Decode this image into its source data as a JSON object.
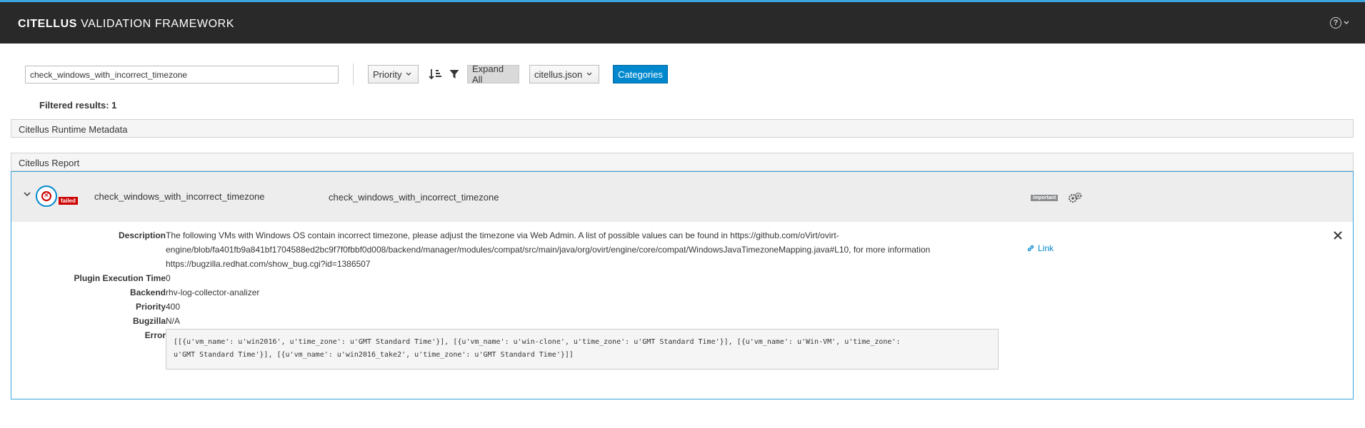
{
  "app": {
    "brand_bold": "CITELLUS",
    "brand_rest": "VALIDATION FRAMEWORK",
    "help_icon": "question-circle-icon"
  },
  "toolbar": {
    "search_value": "check_windows_with_incorrect_timezone",
    "priority_label": "Priority",
    "sort_icon": "sort-amount-icon",
    "filter_icon": "filter-icon",
    "expand_label": "Expand All",
    "json_label": "citellus.json",
    "categories_label": "Categories"
  },
  "results": {
    "filtered_label": "Filtered results: 1"
  },
  "panels": {
    "metadata_title": "Citellus Runtime Metadata",
    "report_title": "Citellus Report"
  },
  "item": {
    "status": "failed",
    "name": "check_windows_with_incorrect_timezone",
    "short_desc": "check_windows_with_incorrect_timezone",
    "badge": "important",
    "colors": {
      "failed": "#cc0000",
      "accent": "#0088ce",
      "important": "#8b8d8f"
    }
  },
  "detail": {
    "description_label": "Description",
    "description_line1": "The following VMs with Windows OS contain incorrect timezone, please adjust the timezone via Web Admin. A list of possible values can be found in https://github.com/oVirt/ovirt-",
    "description_line2": "engine/blob/fa401fb9a841bf1704588ed2bc9f7f0fbbf0d008/backend/manager/modules/compat/src/main/java/org/ovirt/engine/core/compat/WindowsJavaTimezoneMapping.java#L10, for more information",
    "description_line3": "https://bugzilla.redhat.com/show_bug.cgi?id=1386507",
    "link_label": "Link",
    "exec_time_label": "Plugin Execution Time",
    "exec_time_value": "0",
    "backend_label": "Backend",
    "backend_value": "rhv-log-collector-analizer",
    "priority_label": "Priority",
    "priority_value": "400",
    "bugzilla_label": "Bugzilla",
    "bugzilla_value": "N/A",
    "error_label": "Error",
    "error_line1": "[[{u'vm_name': u'win2016', u'time_zone': u'GMT Standard Time'}], [{u'vm_name': u'win-clone', u'time_zone': u'GMT Standard Time'}], [{u'vm_name': u'Win-VM', u'time_zone':",
    "error_line2": "u'GMT Standard Time'}], [{u'vm_name': u'win2016_take2', u'time_zone': u'GMT Standard Time'}]]"
  }
}
